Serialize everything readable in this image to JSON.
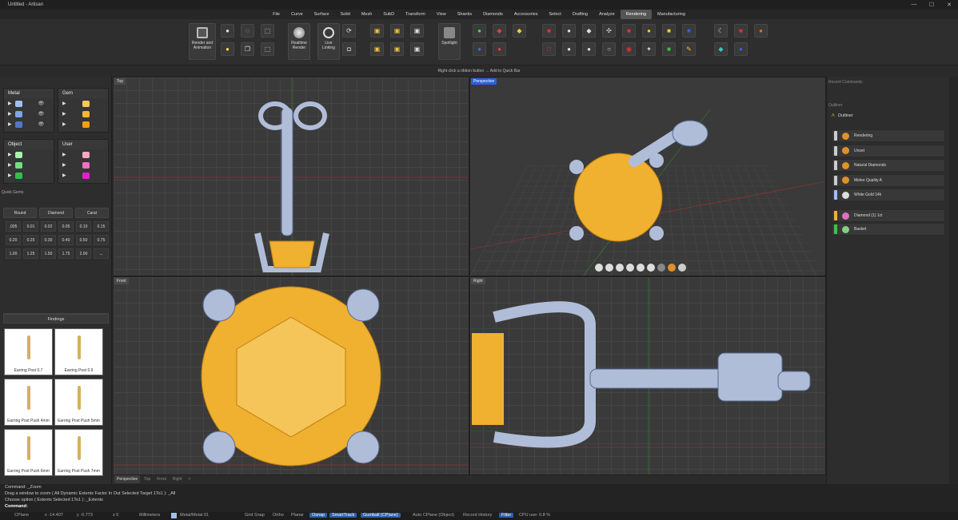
{
  "window": {
    "title": "Untitled - Artisan",
    "buttons": [
      "—",
      "☐",
      "✕"
    ]
  },
  "menu": [
    "File",
    "Curve",
    "Surface",
    "Solid",
    "Mesh",
    "SubD",
    "Transform",
    "View",
    "Shanks",
    "Diamonds",
    "Accessories",
    "Select",
    "Drafting",
    "Analyze",
    "Rendering",
    "Manufacturing"
  ],
  "menu_active": "Rendering",
  "ribbon": {
    "render_label": "Render and Animation",
    "realtime_label": "Realtime Render",
    "live_label": "Live Linking",
    "spotlight_label": "Spotlight",
    "hint": "Right-click a ribbon button → Add to Quick Bar"
  },
  "layers": {
    "metal": {
      "title": "Metal",
      "colors": [
        "#9ec0f0",
        "#7fa6e6",
        "#4f78c8"
      ]
    },
    "gem": {
      "title": "Gem",
      "colors": [
        "#f5c85a",
        "#f5b53a",
        "#f0a010"
      ]
    },
    "object": {
      "title": "Object",
      "colors": [
        "#a8f0b0",
        "#70e080",
        "#30c050"
      ]
    },
    "user": {
      "title": "User",
      "colors": [
        "#f7a8c0",
        "#f070c0",
        "#e020d0"
      ]
    }
  },
  "quick_gems": {
    "title": "Quick Gems",
    "buttons": [
      "Round",
      "Diamond",
      "Carat"
    ],
    "sizes": [
      ".005",
      "0.01",
      "0.02",
      "0.05",
      "0.10",
      "0.15",
      "0.20",
      "0.25",
      "0.30",
      "0.40",
      "0.50",
      "0.75",
      "1.00",
      "1.25",
      "1.50",
      "1.75",
      "2.00",
      "..."
    ]
  },
  "findings": {
    "title": "Findings",
    "items": [
      "Earring Post 0.7",
      "Earring Post 0.9",
      "Earring Post Push 4mm",
      "Earring Post Push 5mm",
      "Earring Post Push 6mm",
      "Earring Post Push 7mm"
    ]
  },
  "viewports": {
    "top": "Top",
    "perspective": "Perspective",
    "front": "Front",
    "right": "Right"
  },
  "viewport_tabs": [
    "Perspective",
    "Top",
    "Front",
    "Right",
    "+"
  ],
  "right": {
    "recent_title": "Recent Commands",
    "outliner_title": "Outliner",
    "outliner_name": "Outliner",
    "items": [
      {
        "label": "Rendering",
        "bar": "#cccccc",
        "icon": "#e0902a"
      },
      {
        "label": "Unset",
        "bar": "#cccccc",
        "icon": "#e0902a"
      },
      {
        "label": "Natural Diamonds",
        "bar": "#cccccc",
        "icon": "#e0902a"
      },
      {
        "label": "Melee Quality A",
        "bar": "#cccccc",
        "icon": "#e0902a"
      },
      {
        "label": "White Gold 14k",
        "bar": "#9ec0f0",
        "icon": "#dddddd"
      },
      {
        "label": "Diamond (1) 1ct",
        "bar": "#f0b040",
        "icon": "#e070c0"
      },
      {
        "label": "Basket",
        "bar": "#40c050",
        "icon": "#80d080"
      }
    ]
  },
  "command": {
    "lines": [
      "Command: _Zoom",
      "Drag a window to zoom ( All  Dynamic  Extents  Factor  In  Out  Selected  Target  1To1 ): _All",
      "Choose option ( Extents  Selected  1To1 ): _Extents",
      "Command:"
    ]
  },
  "status": {
    "cplane": "CPlane",
    "x": "x -14.407",
    "y": "y -0.773",
    "z": "z 0",
    "units": "Millimeters",
    "layer": "Metal/Metal 01",
    "grid_snap": "Grid Snap",
    "ortho": "Ortho",
    "planar": "Planar",
    "osnap": "Osnap",
    "smarttrack": "SmartTrack",
    "gumball": "Gumball (CPlane)",
    "auto_cplane": "Auto CPlane (Object)",
    "record": "Record History",
    "filter": "Filter",
    "cpu": "CPU use: 0.8 %"
  }
}
